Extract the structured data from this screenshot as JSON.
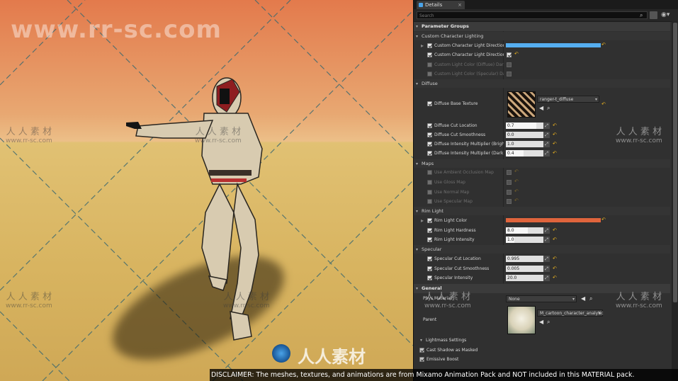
{
  "watermark": {
    "main": "www.rr-sc.com",
    "cn": "人 人 素 材",
    "url": "www.rr-sc.com",
    "bottom": "人人素材"
  },
  "panel": {
    "tab_title": "Details",
    "search_placeholder": "Search",
    "groups": {
      "parameter_groups": "Parameter Groups",
      "custom_lighting": "Custom Character Lighting",
      "diffuse": "Diffuse",
      "maps": "Maps",
      "rim": "Rim Light",
      "specular": "Specular",
      "general": "General",
      "lightmass": "Lightmass Settings"
    },
    "custom_lighting": {
      "light_direction": "Custom Character Light Direction",
      "light_direction_toggle": "Custom Character Light Direction",
      "diffuse_color": "Custom Light Color (Diffuse) Dark",
      "specular_color": "Custom Light Color (Specular) Da"
    },
    "diffuse": {
      "base_texture": "Diffuse Base Texture",
      "texture_name": "ranger-t_diffuse",
      "cut_location": "Diffuse Cut Location",
      "cut_location_val": "0.7",
      "cut_smoothness": "Diffuse Cut Smoothness",
      "cut_smoothness_val": "0.0",
      "intensity_bright": "Diffuse Intensity Multiplier (Bright)",
      "intensity_bright_val": "1.0",
      "intensity_dark": "Diffuse Intensity Multiplier (Dark)",
      "intensity_dark_val": "0.4"
    },
    "maps": {
      "ao": "Use Ambient Occlusion Map",
      "gloss": "Use Gloss Map",
      "normal": "Use Normal Map",
      "specular": "Use Specular Map"
    },
    "rim": {
      "color": "Rim Light Color",
      "hardness": "Rim Light Hardness",
      "hardness_val": "8.0",
      "intensity": "Rim Light Intensity",
      "intensity_val": "1.0"
    },
    "specular": {
      "cut_location": "Specular Cut Location",
      "cut_location_val": "0.995",
      "cut_smoothness": "Specular Cut Smoothness",
      "cut_smoothness_val": "0.005",
      "intensity": "Specular Intensity",
      "intensity_val": "20.0"
    },
    "general": {
      "phys_material": "Phys Material",
      "phys_value": "None",
      "parent": "Parent",
      "parent_value": "M_cartoon_character_analytic"
    },
    "lightmass": {
      "cast_shadow": "Cast Shadow as Masked",
      "emissive_boost": "Emissive Boost"
    }
  },
  "disclaimer": "DISCLAIMER: The meshes, textures, and animations are from Mixamo Animation Pack and NOT included in this MATERIAL pack.",
  "colors": {
    "light_direction_bar": "#55aef0",
    "rim_light_bar": "#e0643c",
    "reset_arrow": "#e8b020"
  }
}
